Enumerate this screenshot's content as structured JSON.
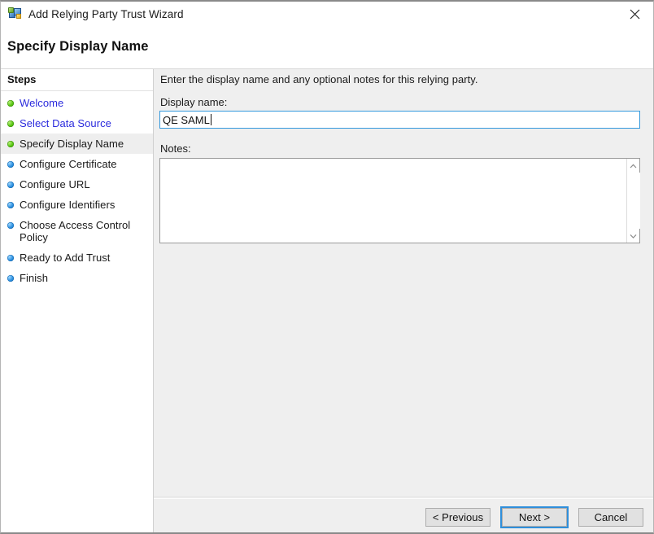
{
  "window": {
    "title": "Add Relying Party Trust Wizard",
    "icon": "relying-party-trust-icon",
    "close_icon": "close-icon"
  },
  "header": {
    "title": "Specify Display Name"
  },
  "sidebar": {
    "title": "Steps",
    "items": [
      {
        "label": "Welcome",
        "bullet": "green",
        "state": "completed"
      },
      {
        "label": "Select Data Source",
        "bullet": "green",
        "state": "completed"
      },
      {
        "label": "Specify Display Name",
        "bullet": "green",
        "state": "current"
      },
      {
        "label": "Configure Certificate",
        "bullet": "blue",
        "state": "pending"
      },
      {
        "label": "Configure URL",
        "bullet": "blue",
        "state": "pending"
      },
      {
        "label": "Configure Identifiers",
        "bullet": "blue",
        "state": "pending"
      },
      {
        "label": "Choose Access Control Policy",
        "bullet": "blue",
        "state": "pending"
      },
      {
        "label": "Ready to Add Trust",
        "bullet": "blue",
        "state": "pending"
      },
      {
        "label": "Finish",
        "bullet": "blue",
        "state": "pending"
      }
    ]
  },
  "main": {
    "intro": "Enter the display name and any optional notes for this relying party.",
    "display_name_label": "Display name:",
    "display_name_value": "QE SAML",
    "display_name_placeholder": "",
    "notes_label": "Notes:",
    "notes_value": "",
    "notes_placeholder": "",
    "scrollbar": {
      "up_icon": "chevron-up-icon",
      "down_icon": "chevron-down-icon"
    }
  },
  "footer": {
    "previous_label": "< Previous",
    "next_label": "Next >",
    "cancel_label": "Cancel"
  },
  "colors": {
    "accent_focus": "#3399dd",
    "link": "#2b2bdd",
    "bullet_done": "#57c412",
    "bullet_pending": "#2b8fe0",
    "panel_bg": "#efefef",
    "sidebar_bg": "#ffffff",
    "current_step_bg": "#eeeeee"
  }
}
